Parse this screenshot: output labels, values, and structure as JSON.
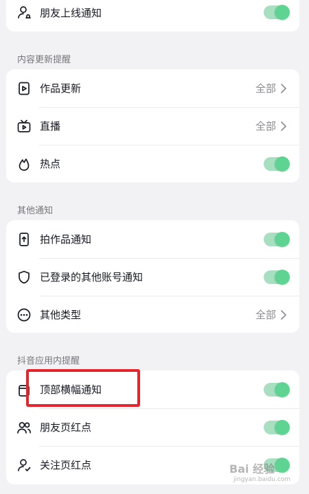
{
  "sections": [
    {
      "title": "",
      "items": [
        {
          "label": "朋友上线通知",
          "icon": "person-bell-icon",
          "control": "toggle",
          "on": true
        }
      ]
    },
    {
      "title": "内容更新提醒",
      "items": [
        {
          "label": "作品更新",
          "icon": "play-file-icon",
          "control": "value",
          "value": "全部"
        },
        {
          "label": "直播",
          "icon": "tv-live-icon",
          "control": "value",
          "value": "全部"
        },
        {
          "label": "热点",
          "icon": "flame-icon",
          "control": "toggle",
          "on": true
        }
      ]
    },
    {
      "title": "其他通知",
      "items": [
        {
          "label": "拍作品通知",
          "icon": "phone-upload-icon",
          "control": "toggle",
          "on": true
        },
        {
          "label": "已登录的其他账号通知",
          "icon": "shield-icon",
          "control": "toggle",
          "on": true
        },
        {
          "label": "其他类型",
          "icon": "more-circle-icon",
          "control": "value",
          "value": "全部"
        }
      ]
    },
    {
      "title": "抖音应用内提醒",
      "items": [
        {
          "label": "顶部横幅通知",
          "icon": "banner-icon",
          "control": "toggle",
          "on": true
        },
        {
          "label": "朋友页红点",
          "icon": "friends-icon",
          "control": "toggle",
          "on": true
        },
        {
          "label": "关注页红点",
          "icon": "person-check-icon",
          "control": "toggle",
          "on": true
        }
      ]
    }
  ],
  "colors": {
    "toggle_on": "#5fd492",
    "highlight": "#e4252b",
    "background": "#f2f2f4"
  },
  "watermark": {
    "text": "Bai 经验",
    "sub": "jingyan.baidu.com"
  }
}
